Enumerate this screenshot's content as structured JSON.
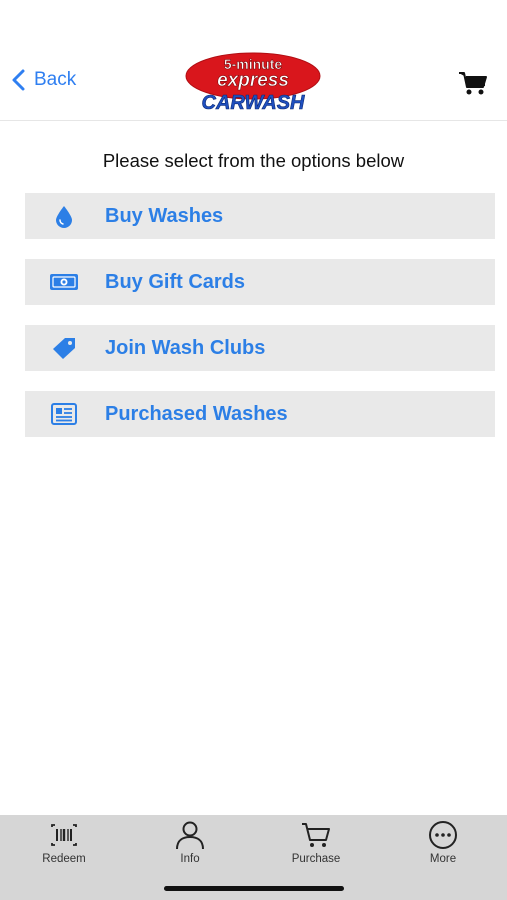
{
  "header": {
    "back_label": "Back",
    "logo": {
      "line1": "5-minute",
      "line2": "express",
      "line3": "CARWASH"
    }
  },
  "prompt": "Please select from the options below",
  "options": [
    {
      "label": "Buy Washes",
      "icon": "water-drop-icon"
    },
    {
      "label": "Buy Gift Cards",
      "icon": "cash-icon"
    },
    {
      "label": "Join Wash Clubs",
      "icon": "tag-icon"
    },
    {
      "label": "Purchased Washes",
      "icon": "receipt-icon"
    }
  ],
  "tabbar": [
    {
      "label": "Redeem",
      "icon": "barcode-icon"
    },
    {
      "label": "Info",
      "icon": "person-icon"
    },
    {
      "label": "Purchase",
      "icon": "cart-icon"
    },
    {
      "label": "More",
      "icon": "more-icon"
    }
  ],
  "colors": {
    "accent": "#2c7fe6",
    "option_bg": "#e9e9e9",
    "tabbar_bg": "#d6d6d6",
    "logo_red": "#d9161c",
    "logo_blue": "#1f4fbf"
  }
}
